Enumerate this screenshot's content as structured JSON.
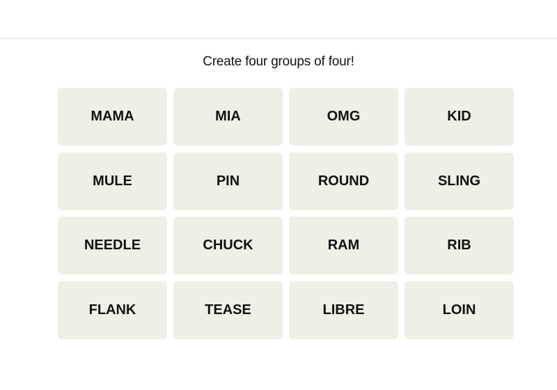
{
  "header": {},
  "subtitle": "Create four groups of four!",
  "tiles": [
    "MAMA",
    "MIA",
    "OMG",
    "KID",
    "MULE",
    "PIN",
    "ROUND",
    "SLING",
    "NEEDLE",
    "CHUCK",
    "RAM",
    "RIB",
    "FLANK",
    "TEASE",
    "LIBRE",
    "LOIN"
  ],
  "colors": {
    "tile_bg": "#efefe6",
    "text": "#121212"
  }
}
